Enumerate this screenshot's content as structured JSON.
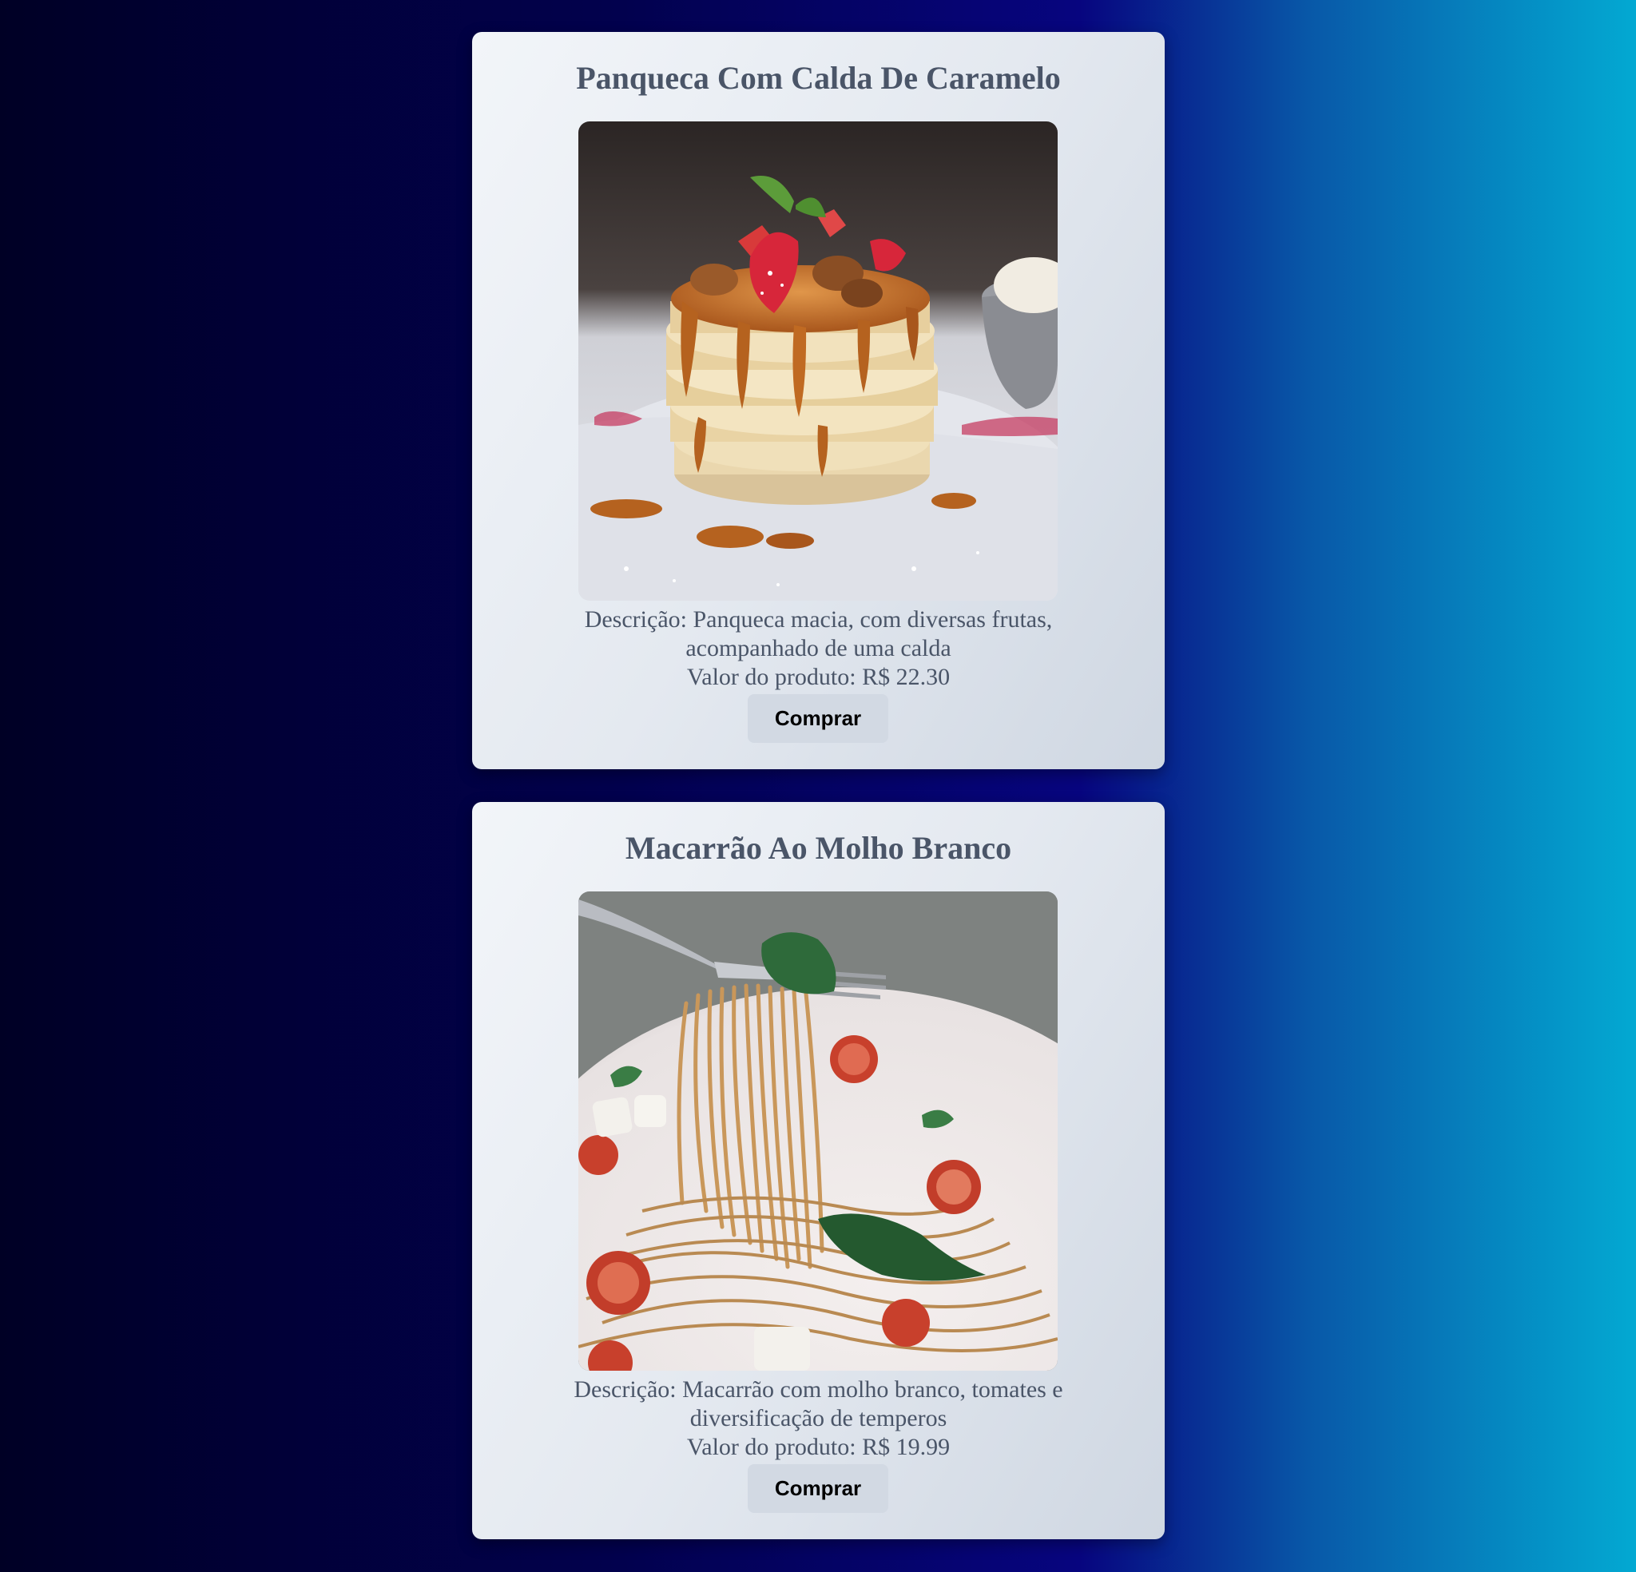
{
  "products": [
    {
      "title": "Panqueca Com Calda De Caramelo",
      "description": "Descrição: Panqueca macia, com diversas frutas, acompanhado de uma calda",
      "price": "Valor do produto: R$ 22.30",
      "button_label": "Comprar",
      "image_alt": "Panqueca com calda de caramelo"
    },
    {
      "title": "Macarrão Ao Molho Branco",
      "description": "Descrição: Macarrão com molho branco, tomates e diversificação de temperos",
      "price": "Valor do produto: R$ 19.99",
      "button_label": "Comprar",
      "image_alt": "Macarrão ao molho branco"
    }
  ]
}
